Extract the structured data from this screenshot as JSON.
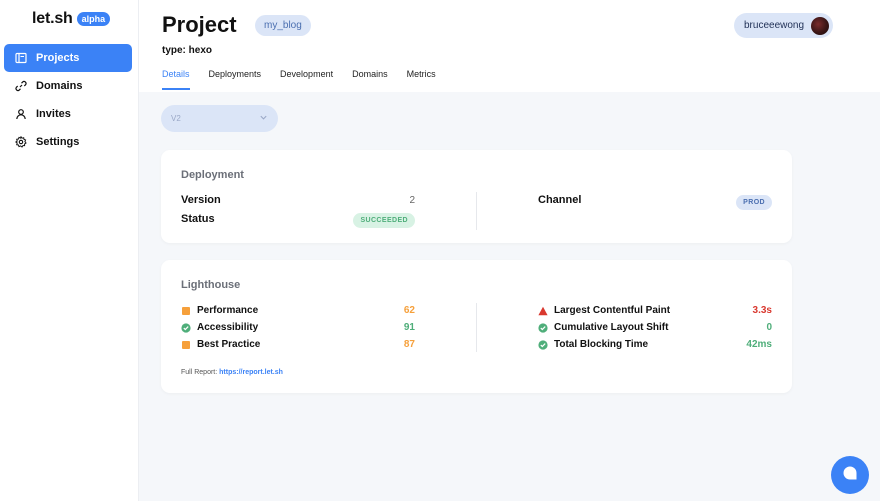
{
  "app": {
    "logo": "let.sh",
    "badge": "alpha"
  },
  "sidebar": {
    "items": [
      {
        "label": "Projects",
        "icon": "projects-icon",
        "active": true
      },
      {
        "label": "Domains",
        "icon": "link-icon"
      },
      {
        "label": "Invites",
        "icon": "user-icon"
      },
      {
        "label": "Settings",
        "icon": "gear-icon"
      }
    ]
  },
  "header": {
    "title": "Project",
    "project_name": "my_blog",
    "type_line": "type: hexo",
    "user": "bruceeewong",
    "tabs": [
      {
        "label": "Details",
        "active": true
      },
      {
        "label": "Deployments"
      },
      {
        "label": "Development"
      },
      {
        "label": "Domains"
      },
      {
        "label": "Metrics"
      }
    ]
  },
  "version_select": {
    "value": "V2"
  },
  "deployment": {
    "title": "Deployment",
    "version_label": "Version",
    "version_value": "2",
    "status_label": "Status",
    "status_value": "SUCCEEDED",
    "channel_label": "Channel",
    "channel_value": "PROD"
  },
  "lighthouse": {
    "title": "Lighthouse",
    "left": [
      {
        "label": "Performance",
        "value": "62",
        "icon": "orange-square-icon",
        "color": "#f6a03b"
      },
      {
        "label": "Accessibility",
        "value": "91",
        "icon": "green-check-icon",
        "color": "#4fae7a"
      },
      {
        "label": "Best Practice",
        "value": "87",
        "icon": "orange-square-icon",
        "color": "#f6a03b"
      }
    ],
    "right": [
      {
        "label": "Largest Contentful Paint",
        "value": "3.3s",
        "icon": "red-triangle-icon",
        "color": "#d9382f"
      },
      {
        "label": "Cumulative Layout Shift",
        "value": "0",
        "icon": "green-check-icon",
        "color": "#4fae7a"
      },
      {
        "label": "Total Blocking Time",
        "value": "42ms",
        "icon": "green-check-icon",
        "color": "#4fae7a"
      }
    ],
    "report_label": "Full Report:",
    "report_link": "https://report.let.sh"
  },
  "colors": {
    "accent": "#3b82f6",
    "success": "#4fae7a",
    "warning": "#f6a03b",
    "error": "#d9382f"
  }
}
